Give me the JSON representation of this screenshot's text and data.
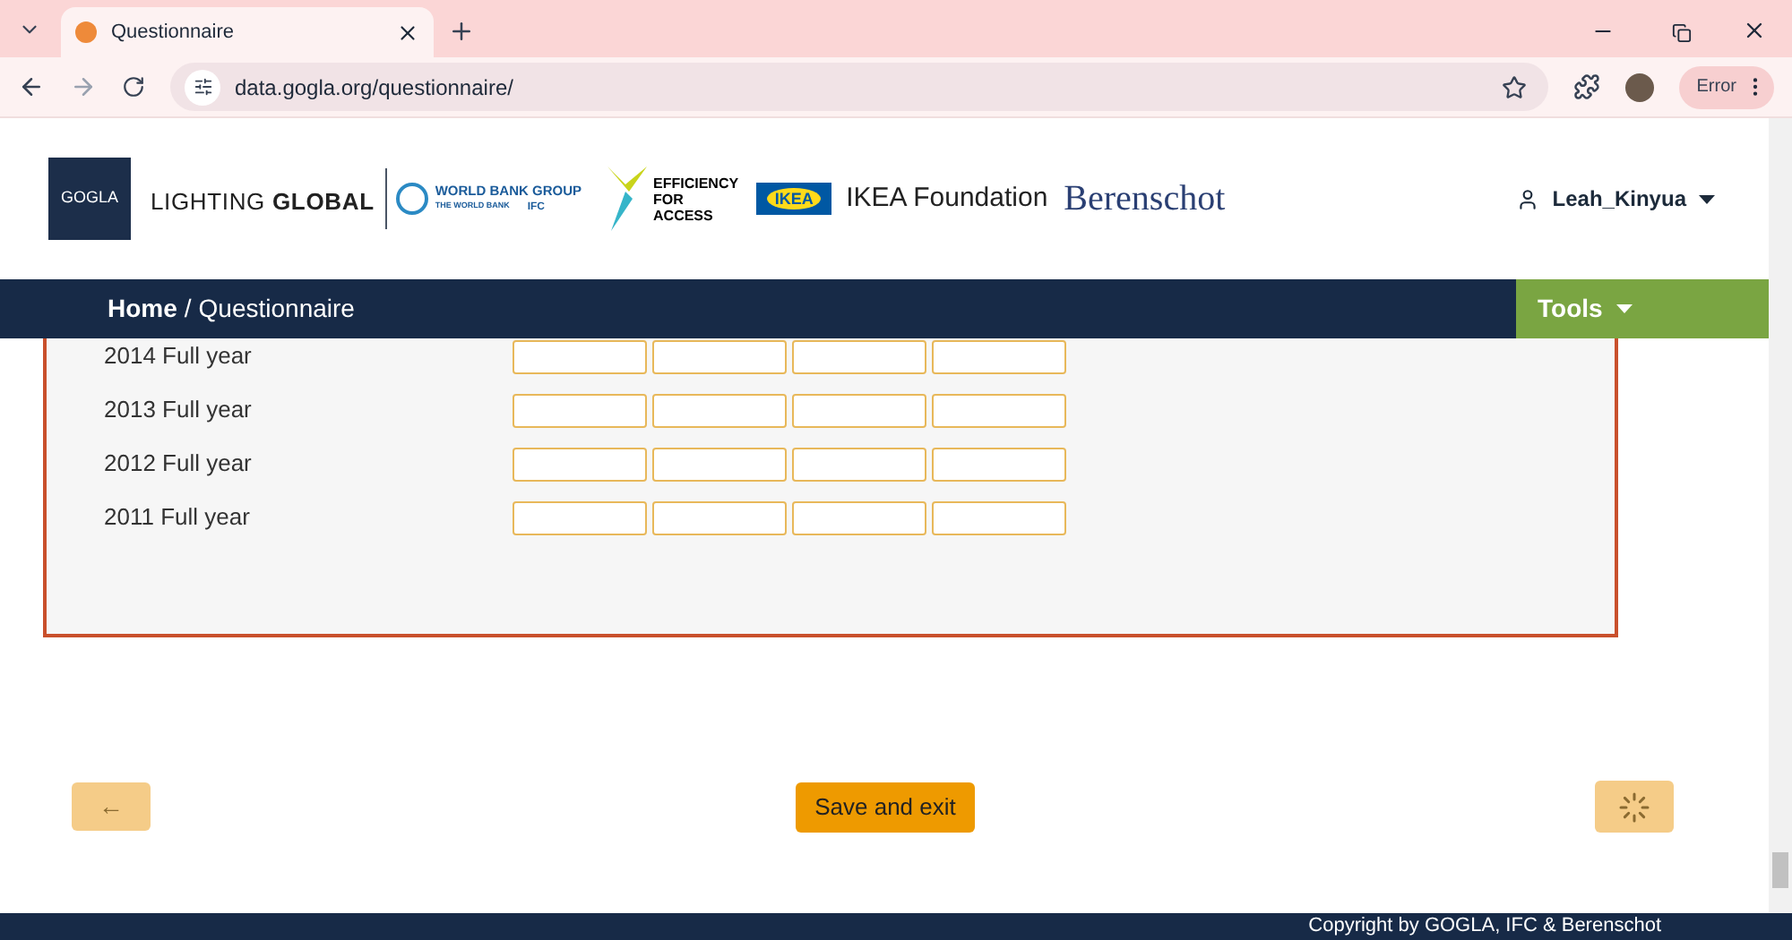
{
  "browser": {
    "tab_title": "Questionnaire",
    "url": "data.gogla.org/questionnaire/",
    "profile_status": "Error"
  },
  "logos": {
    "gogla": "GOGLA",
    "lighting_global": [
      "LIGHTING",
      "GLOBAL"
    ],
    "world_bank": {
      "top": "WORLD BANK GROUP",
      "left": "THE WORLD BANK",
      "right": "IFC"
    },
    "efficiency": [
      "EFFICIENCY",
      "FOR",
      "ACCESS"
    ],
    "ikea_badge": "IKEA",
    "ikea_foundation": "IKEA Foundation",
    "berenschot": "Berenschot"
  },
  "user": {
    "name": "Leah_Kinyua"
  },
  "breadcrumb": {
    "home": "Home",
    "separator": "/",
    "current": "Questionnaire"
  },
  "tools": {
    "label": "Tools"
  },
  "rows": [
    {
      "label": "2014 Full year"
    },
    {
      "label": "2013 Full year"
    },
    {
      "label": "2012 Full year"
    },
    {
      "label": "2011 Full year"
    }
  ],
  "buttons": {
    "back": {
      "label": "←",
      "disabled": true
    },
    "save": {
      "label": "Save and exit",
      "disabled": false
    },
    "next": {
      "disabled": true
    }
  },
  "footer": "Copyright by GOGLA, IFC & Berenschot"
}
